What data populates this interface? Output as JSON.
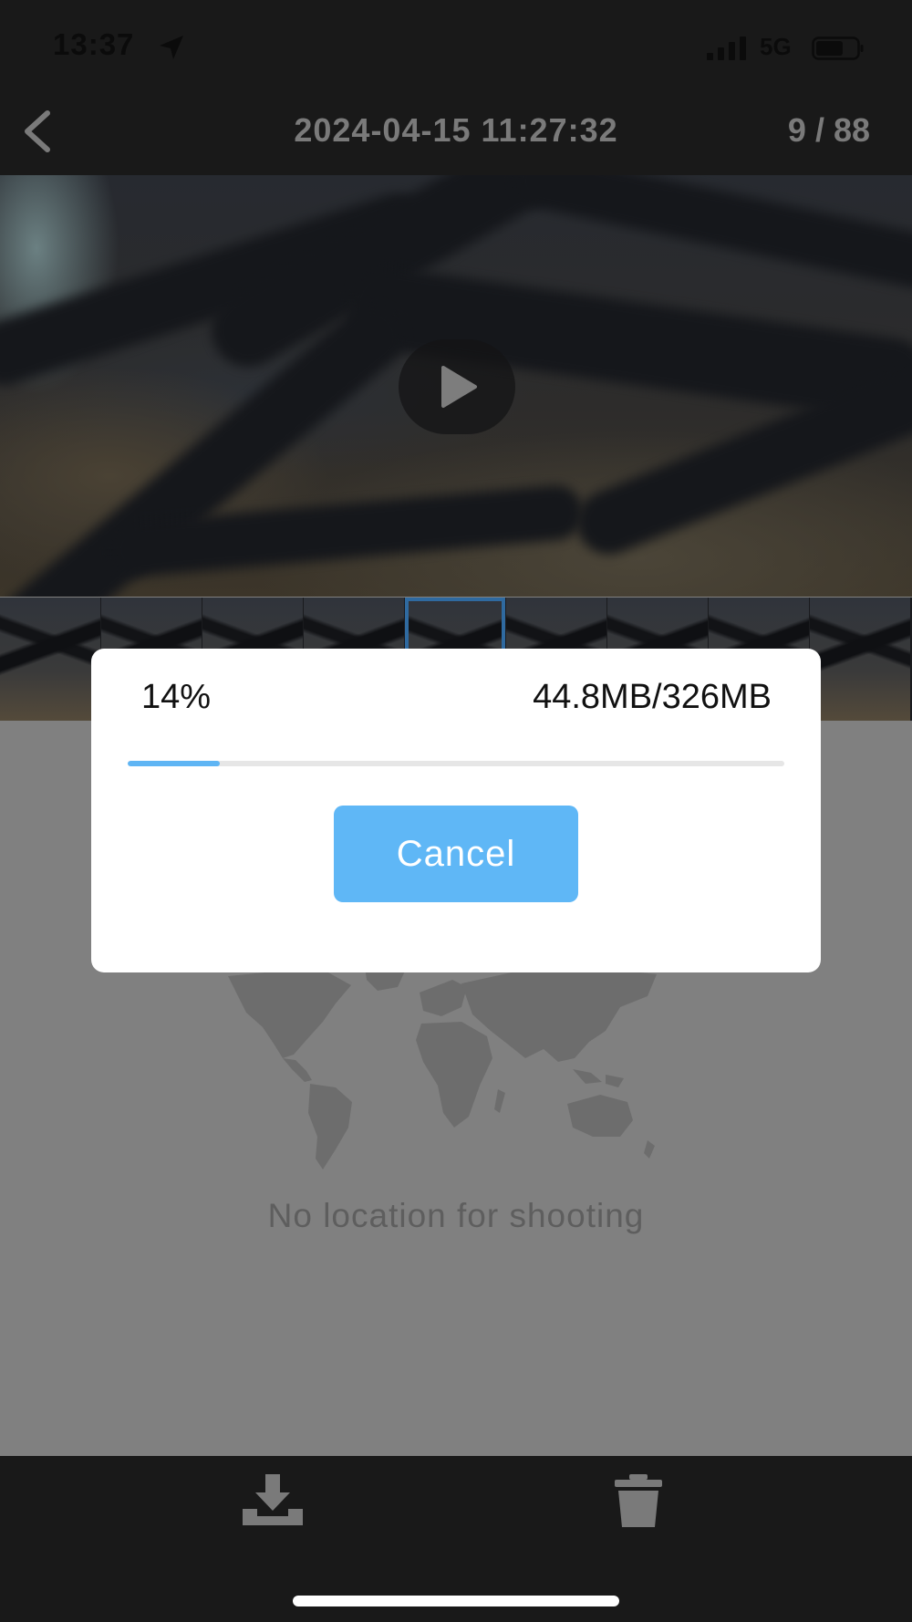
{
  "status_bar": {
    "time": "13:37",
    "network": "5G",
    "icons": [
      "location-arrow-icon",
      "signal-bars-icon",
      "battery-icon"
    ]
  },
  "nav": {
    "back_icon": "chevron-left-icon",
    "title": "2024-04-15 11:27:32",
    "counter": "9 / 88"
  },
  "video": {
    "play_icon": "play-icon"
  },
  "thumbnails": {
    "count": 9,
    "selected_index": 4
  },
  "empty_state": {
    "map_icon": "world-map-icon",
    "message": "No location for shooting"
  },
  "toolbar": {
    "download_icon": "download-icon",
    "delete_icon": "trash-icon"
  },
  "download_dialog": {
    "percent_label": "14%",
    "progress_fraction": 0.14,
    "size_label": "44.8MB/326MB",
    "cancel_label": "Cancel"
  },
  "colors": {
    "accent": "#5fb7f6",
    "overlay_gray": "#808080",
    "bar_dark": "#191919"
  }
}
